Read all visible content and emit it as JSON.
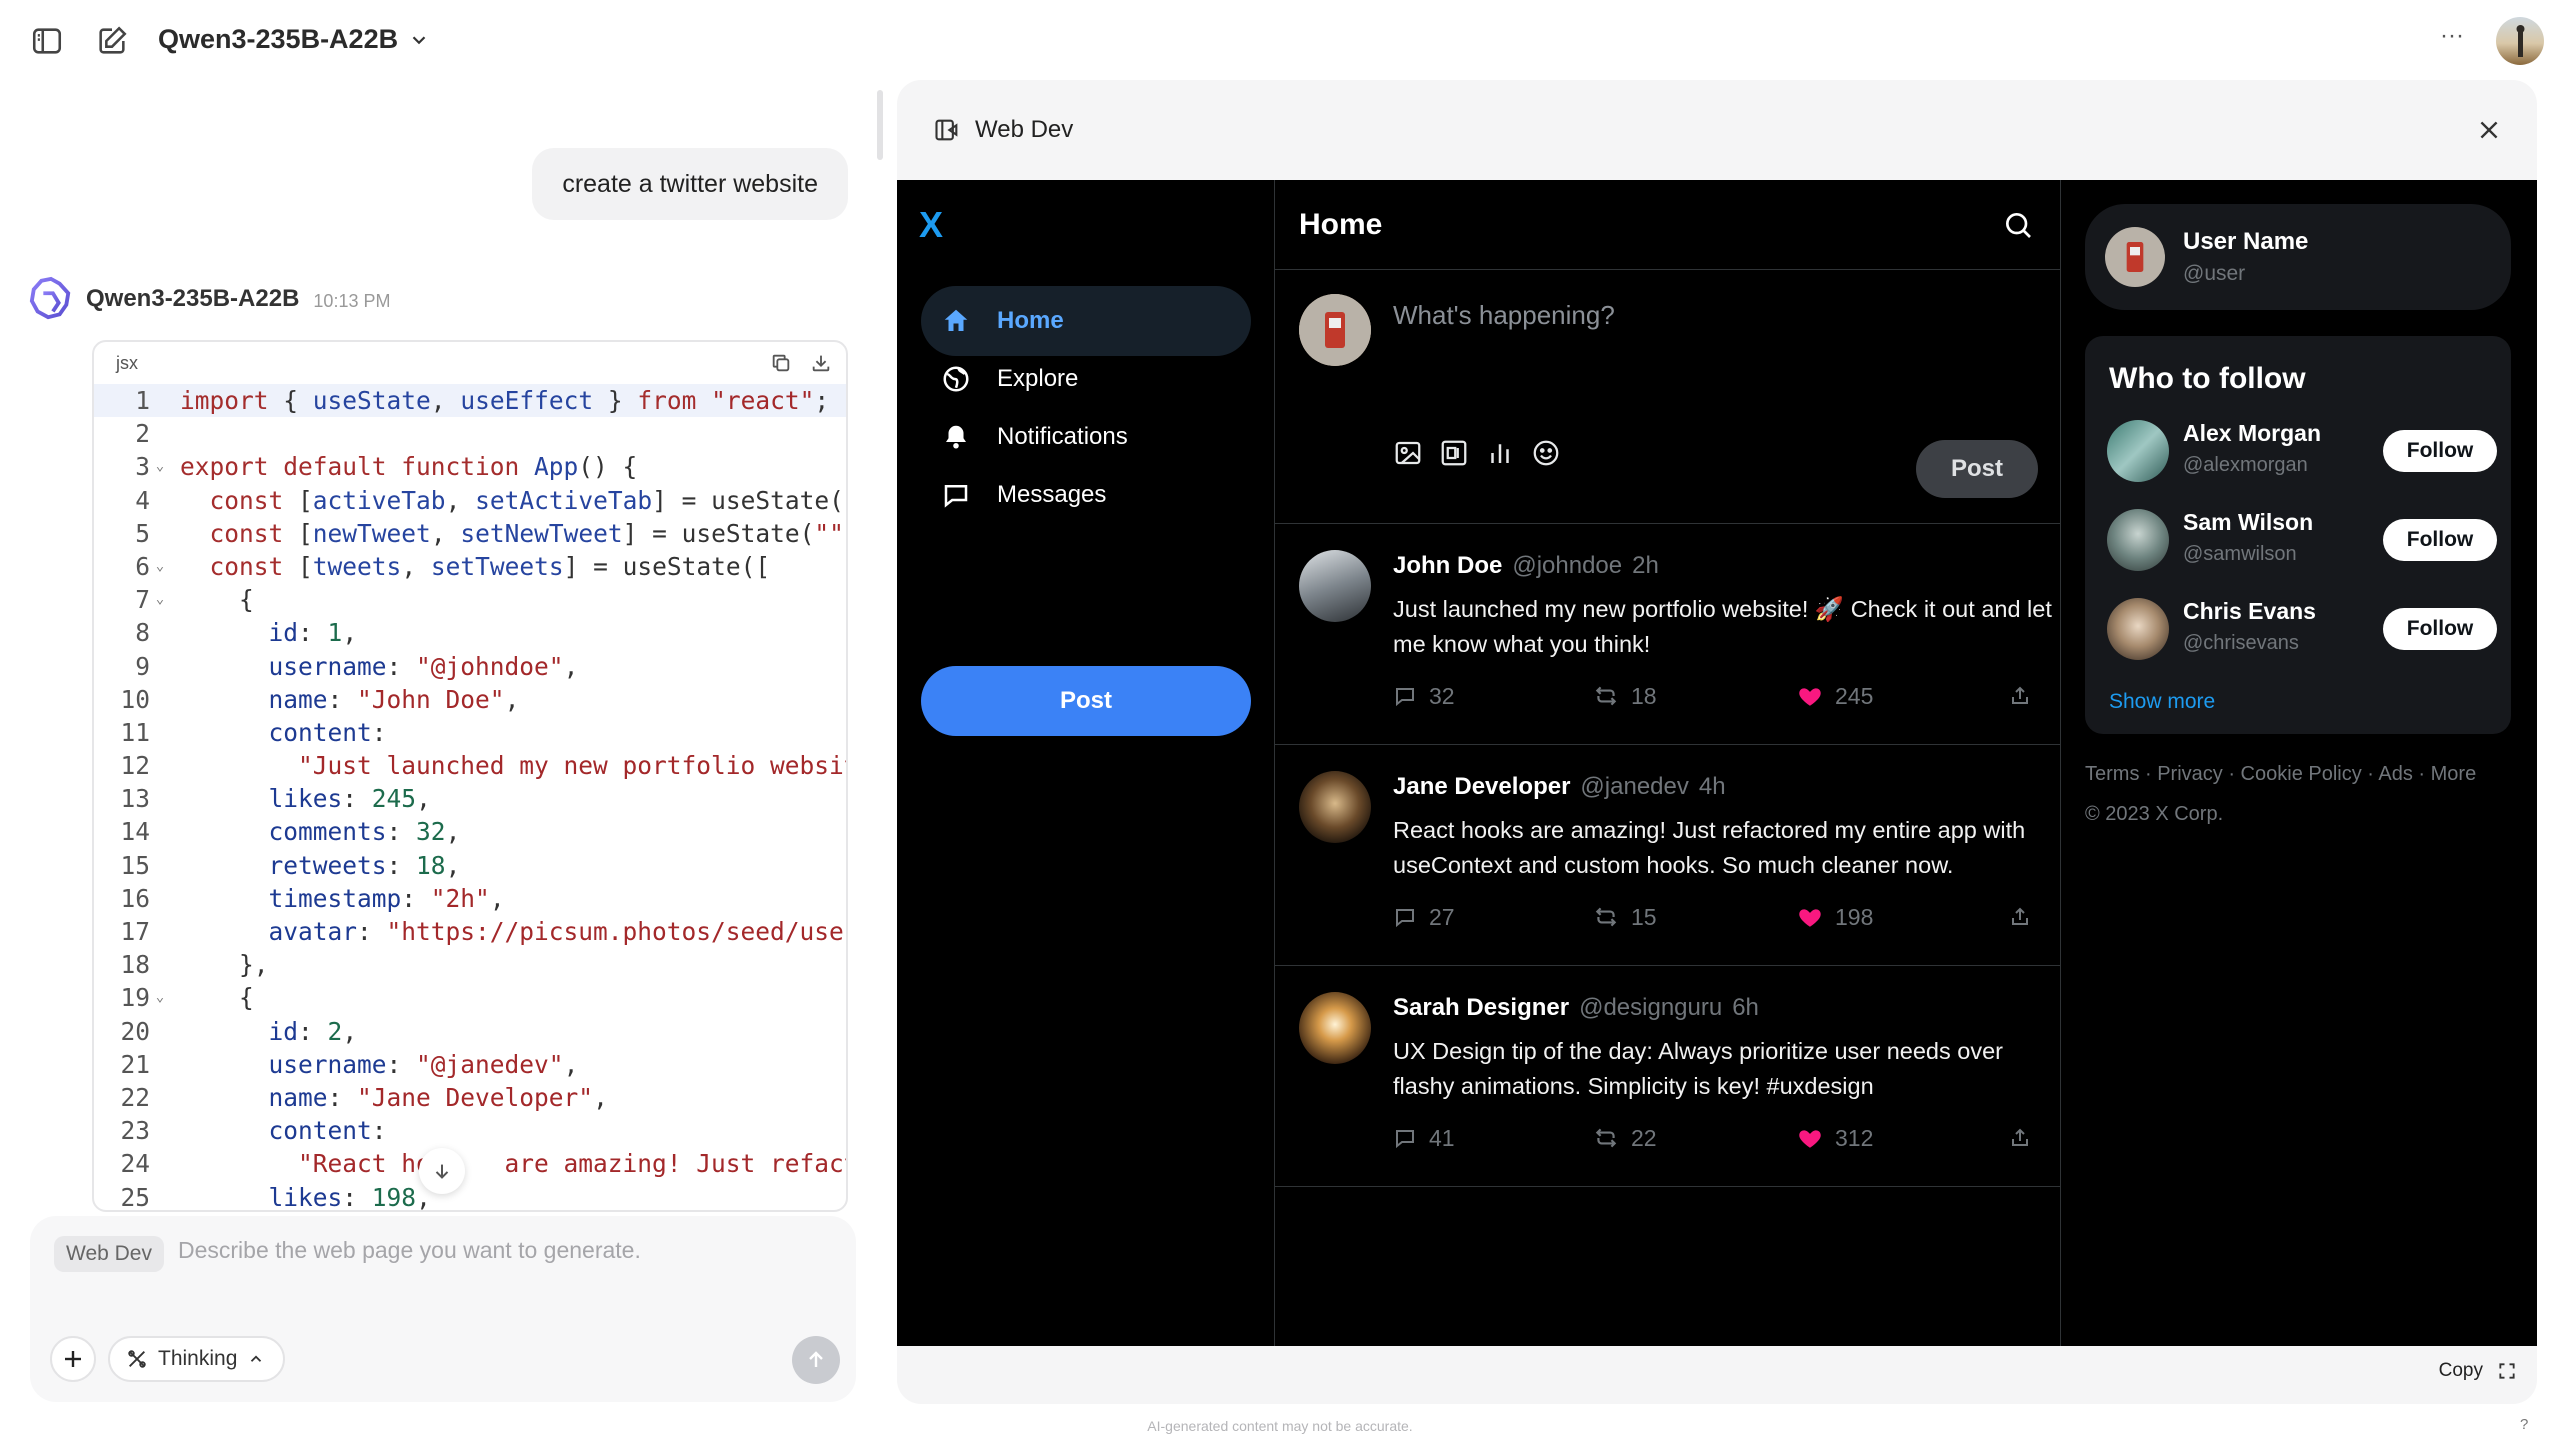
{
  "topbar": {
    "model_name": "Qwen3-235B-A22B",
    "more_label": "···"
  },
  "chat": {
    "user_message": "create a twitter website",
    "assistant_name": "Qwen3-235B-A22B",
    "assistant_time": "10:13 PM",
    "code_language": "jsx",
    "code_lines": [
      {
        "n": "1",
        "fold": ""
      },
      {
        "n": "2",
        "fold": ""
      },
      {
        "n": "3",
        "fold": "⌄"
      },
      {
        "n": "4",
        "fold": ""
      },
      {
        "n": "5",
        "fold": ""
      },
      {
        "n": "6",
        "fold": "⌄"
      },
      {
        "n": "7",
        "fold": "⌄"
      },
      {
        "n": "8",
        "fold": ""
      },
      {
        "n": "9",
        "fold": ""
      },
      {
        "n": "10",
        "fold": ""
      },
      {
        "n": "11",
        "fold": ""
      },
      {
        "n": "12",
        "fold": ""
      },
      {
        "n": "13",
        "fold": ""
      },
      {
        "n": "14",
        "fold": ""
      },
      {
        "n": "15",
        "fold": ""
      },
      {
        "n": "16",
        "fold": ""
      },
      {
        "n": "17",
        "fold": ""
      },
      {
        "n": "18",
        "fold": ""
      },
      {
        "n": "19",
        "fold": "⌄"
      },
      {
        "n": "20",
        "fold": ""
      },
      {
        "n": "21",
        "fold": ""
      },
      {
        "n": "22",
        "fold": ""
      },
      {
        "n": "23",
        "fold": ""
      },
      {
        "n": "24",
        "fold": ""
      },
      {
        "n": "25",
        "fold": ""
      }
    ],
    "code_text": [
      [
        [
          "kw",
          "import "
        ],
        [
          "pl",
          "{ "
        ],
        [
          "fn",
          "useState"
        ],
        [
          "pl",
          ", "
        ],
        [
          "fn",
          "useEffect"
        ],
        [
          "pl",
          " } "
        ],
        [
          "kw",
          "from "
        ],
        [
          "st",
          "\"react\""
        ],
        [
          "pl",
          ";"
        ]
      ],
      [],
      [
        [
          "kw",
          "export default function "
        ],
        [
          "fn",
          "App"
        ],
        [
          "pl",
          "() {"
        ]
      ],
      [
        [
          "pl",
          "  "
        ],
        [
          "kw",
          "const "
        ],
        [
          "pl",
          "["
        ],
        [
          "fn",
          "activeTab"
        ],
        [
          "pl",
          ", "
        ],
        [
          "fn",
          "setActiveTab"
        ],
        [
          "pl",
          "] = useState('"
        ]
      ],
      [
        [
          "pl",
          "  "
        ],
        [
          "kw",
          "const "
        ],
        [
          "pl",
          "["
        ],
        [
          "fn",
          "newTweet"
        ],
        [
          "pl",
          ", "
        ],
        [
          "fn",
          "setNewTweet"
        ],
        [
          "pl",
          "] = useState("
        ],
        [
          "st",
          "\"\""
        ],
        [
          "pl",
          ")"
        ]
      ],
      [
        [
          "pl",
          "  "
        ],
        [
          "kw",
          "const "
        ],
        [
          "pl",
          "["
        ],
        [
          "fn",
          "tweets"
        ],
        [
          "pl",
          ", "
        ],
        [
          "fn",
          "setTweets"
        ],
        [
          "pl",
          "] = useState(["
        ]
      ],
      [
        [
          "pl",
          "    {"
        ]
      ],
      [
        [
          "pl",
          "      "
        ],
        [
          "pr",
          "id"
        ],
        [
          "pl",
          ": "
        ],
        [
          "nm",
          "1"
        ],
        [
          "pl",
          ","
        ]
      ],
      [
        [
          "pl",
          "      "
        ],
        [
          "pr",
          "username"
        ],
        [
          "pl",
          ": "
        ],
        [
          "st",
          "\"@johndoe\""
        ],
        [
          "pl",
          ","
        ]
      ],
      [
        [
          "pl",
          "      "
        ],
        [
          "pr",
          "name"
        ],
        [
          "pl",
          ": "
        ],
        [
          "st",
          "\"John Doe\""
        ],
        [
          "pl",
          ","
        ]
      ],
      [
        [
          "pl",
          "      "
        ],
        [
          "pr",
          "content"
        ],
        [
          "pl",
          ":"
        ]
      ],
      [
        [
          "pl",
          "        "
        ],
        [
          "st",
          "\"Just launched my new portfolio websit"
        ]
      ],
      [
        [
          "pl",
          "      "
        ],
        [
          "pr",
          "likes"
        ],
        [
          "pl",
          ": "
        ],
        [
          "nm",
          "245"
        ],
        [
          "pl",
          ","
        ]
      ],
      [
        [
          "pl",
          "      "
        ],
        [
          "pr",
          "comments"
        ],
        [
          "pl",
          ": "
        ],
        [
          "nm",
          "32"
        ],
        [
          "pl",
          ","
        ]
      ],
      [
        [
          "pl",
          "      "
        ],
        [
          "pr",
          "retweets"
        ],
        [
          "pl",
          ": "
        ],
        [
          "nm",
          "18"
        ],
        [
          "pl",
          ","
        ]
      ],
      [
        [
          "pl",
          "      "
        ],
        [
          "pr",
          "timestamp"
        ],
        [
          "pl",
          ": "
        ],
        [
          "st",
          "\"2h\""
        ],
        [
          "pl",
          ","
        ]
      ],
      [
        [
          "pl",
          "      "
        ],
        [
          "pr",
          "avatar"
        ],
        [
          "pl",
          ": "
        ],
        [
          "st",
          "\"https://picsum.photos/seed/user"
        ]
      ],
      [
        [
          "pl",
          "    },"
        ]
      ],
      [
        [
          "pl",
          "    {"
        ]
      ],
      [
        [
          "pl",
          "      "
        ],
        [
          "pr",
          "id"
        ],
        [
          "pl",
          ": "
        ],
        [
          "nm",
          "2"
        ],
        [
          "pl",
          ","
        ]
      ],
      [
        [
          "pl",
          "      "
        ],
        [
          "pr",
          "username"
        ],
        [
          "pl",
          ": "
        ],
        [
          "st",
          "\"@janedev\""
        ],
        [
          "pl",
          ","
        ]
      ],
      [
        [
          "pl",
          "      "
        ],
        [
          "pr",
          "name"
        ],
        [
          "pl",
          ": "
        ],
        [
          "st",
          "\"Jane Developer\""
        ],
        [
          "pl",
          ","
        ]
      ],
      [
        [
          "pl",
          "      "
        ],
        [
          "pr",
          "content"
        ],
        [
          "pl",
          ":"
        ]
      ],
      [
        [
          "pl",
          "        "
        ],
        [
          "st",
          "\"React ho"
        ],
        [
          "pl",
          "     "
        ],
        [
          "st",
          "are amazing! Just refacto"
        ]
      ],
      [
        [
          "pl",
          "      "
        ],
        [
          "pr",
          "likes"
        ],
        [
          "pl",
          ": "
        ],
        [
          "nm",
          "198"
        ],
        [
          "pl",
          ","
        ]
      ]
    ],
    "composer": {
      "tag": "Web Dev",
      "placeholder": "Describe the web page you want to generate.",
      "thinking_label": "Thinking"
    }
  },
  "panel": {
    "title": "Web Dev",
    "copy_label": "Copy",
    "disclaimer": "AI-generated content may not be accurate.",
    "help": "?"
  },
  "preview": {
    "logo": "X",
    "nav": [
      {
        "label": "Home",
        "icon": "home-icon",
        "active": true
      },
      {
        "label": "Explore",
        "icon": "globe-icon",
        "active": false
      },
      {
        "label": "Notifications",
        "icon": "bell-icon",
        "active": false
      },
      {
        "label": "Messages",
        "icon": "message-icon",
        "active": false
      }
    ],
    "post_button": "Post",
    "main_title": "Home",
    "compose_placeholder": "What's happening?",
    "compose_post": "Post",
    "tweets": [
      {
        "name": "John Doe",
        "handle": "@johndoe",
        "time": "2h",
        "content": "Just launched my new portfolio website! 🚀 Check it out and let me know what you think!",
        "comments": "32",
        "retweets": "18",
        "likes": "245"
      },
      {
        "name": "Jane Developer",
        "handle": "@janedev",
        "time": "4h",
        "content": "React hooks are amazing! Just refactored my entire app with useContext and custom hooks. So much cleaner now.",
        "comments": "27",
        "retweets": "15",
        "likes": "198"
      },
      {
        "name": "Sarah Designer",
        "handle": "@designguru",
        "time": "6h",
        "content": "UX Design tip of the day: Always prioritize user needs over flashy animations. Simplicity is key! #uxdesign",
        "comments": "41",
        "retweets": "22",
        "likes": "312"
      }
    ],
    "profile": {
      "name": "User Name",
      "handle": "@user"
    },
    "who_to_follow": {
      "title": "Who to follow",
      "users": [
        {
          "name": "Alex Morgan",
          "handle": "@alexmorgan",
          "button": "Follow"
        },
        {
          "name": "Sam Wilson",
          "handle": "@samwilson",
          "button": "Follow"
        },
        {
          "name": "Chris Evans",
          "handle": "@chrisevans",
          "button": "Follow"
        }
      ],
      "show_more": "Show more"
    },
    "footer": {
      "links": "Terms · Privacy · Cookie Policy · Ads · More",
      "copyright": "© 2023 X Corp."
    },
    "colors": {
      "accent": "#1d9bf0",
      "post_button": "#3b82f6",
      "like": "#f91880"
    }
  }
}
